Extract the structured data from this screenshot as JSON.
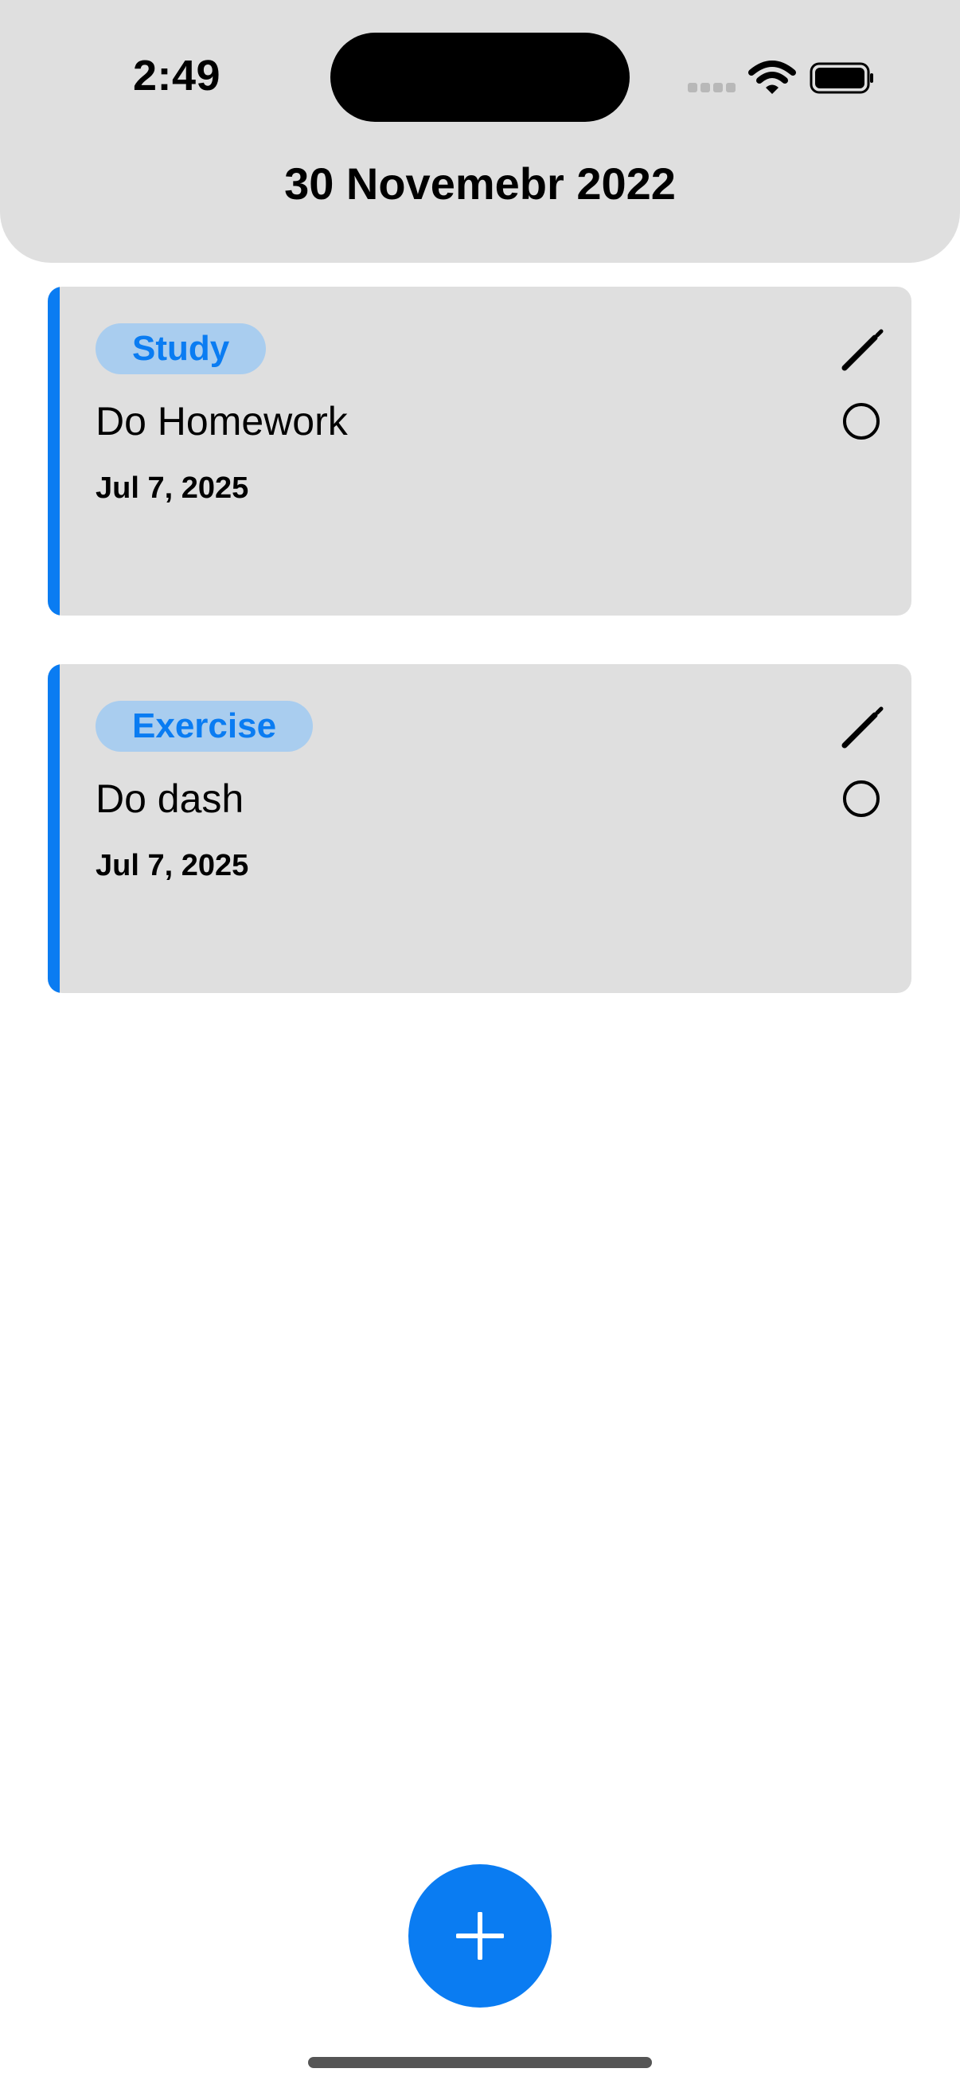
{
  "status_bar": {
    "time": "2:49"
  },
  "header": {
    "title": "30 Novemebr 2022"
  },
  "tasks": [
    {
      "category": "Study",
      "title": "Do Homework",
      "date": "Jul 7, 2025"
    },
    {
      "category": "Exercise",
      "title": "Do dash",
      "date": "Jul 7, 2025"
    }
  ],
  "icons": {
    "edit": "pencil-icon",
    "complete": "circle-icon",
    "add": "plus-icon",
    "wifi": "wifi-icon",
    "battery": "battery-icon",
    "signal": "signal-icon"
  },
  "colors": {
    "accent": "#0a7cf2",
    "tag_background": "#a9cdef",
    "card_background": "#dfdfdf",
    "header_background": "#dfdfdf"
  }
}
